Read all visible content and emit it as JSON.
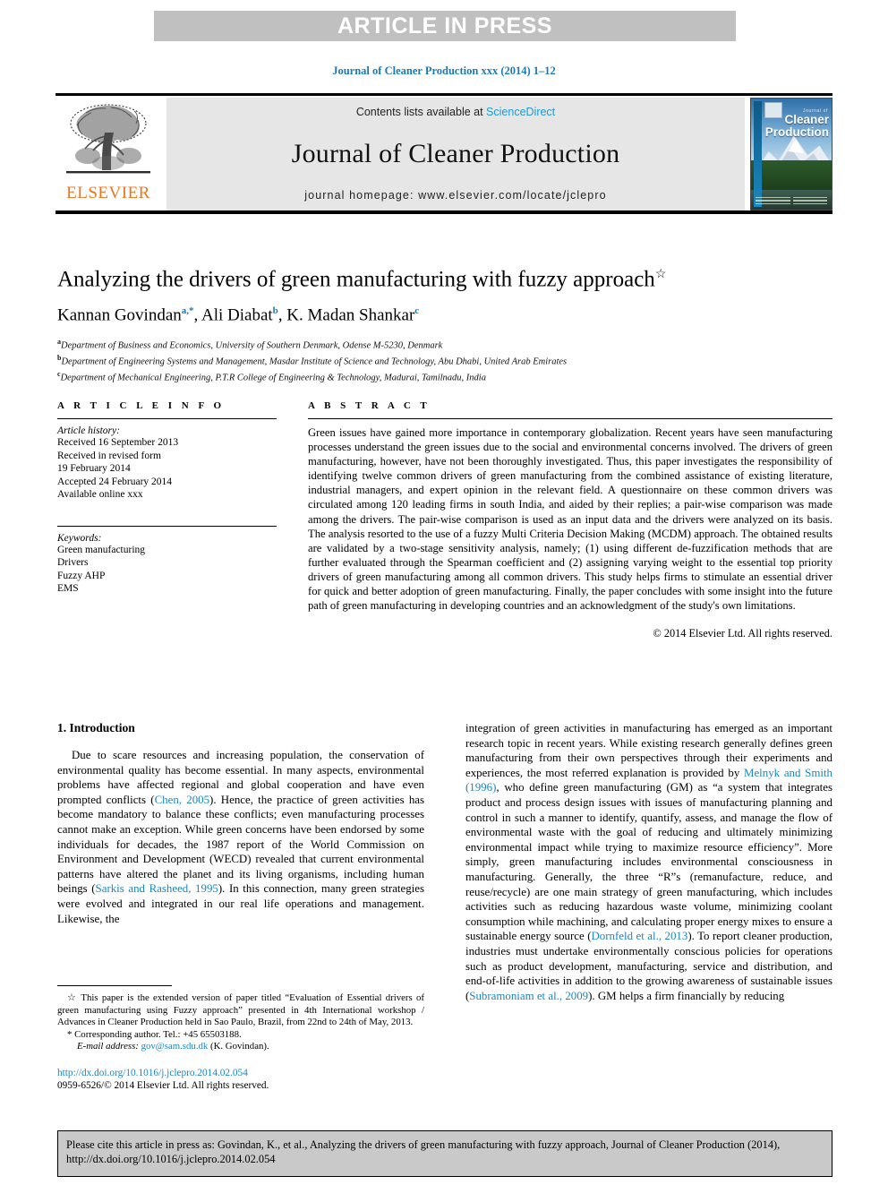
{
  "banner": {
    "text": "ARTICLE IN PRESS"
  },
  "running_head": "Journal of Cleaner Production xxx (2014) 1–12",
  "masthead": {
    "contents_prefix": "Contents lists available at ",
    "sciencedirect": "ScienceDirect",
    "journal_title": "Journal of Cleaner Production",
    "homepage": "journal homepage: www.elsevier.com/locate/jclepro",
    "publisher": "ELSEVIER",
    "cover_kicker": "Journal of",
    "cover_name": "Cleaner Production",
    "link_color": "#1a9bd7",
    "publisher_color": "#e87722"
  },
  "article": {
    "title": "Analyzing the drivers of green manufacturing with fuzzy approach",
    "title_footnote_mark": "☆",
    "authors": "Kannan Govindan , Ali Diabat , K. Madan Shankar",
    "author_list": [
      {
        "name": "Kannan Govindan",
        "marks": "a,*"
      },
      {
        "name": "Ali Diabat",
        "marks": "b"
      },
      {
        "name": "K. Madan Shankar",
        "marks": "c"
      }
    ],
    "affiliations": [
      {
        "mark": "a",
        "text": "Department of Business and Economics, University of Southern Denmark, Odense M-5230, Denmark"
      },
      {
        "mark": "b",
        "text": "Department of Engineering Systems and Management, Masdar Institute of Science and Technology, Abu Dhabi, United Arab Emirates"
      },
      {
        "mark": "c",
        "text": "Department of Mechanical Engineering, P.T.R College of Engineering & Technology, Madurai, Tamilnadu, India"
      }
    ]
  },
  "article_info": {
    "heading": "A R T I C L E  I N F O",
    "history_label": "Article history:",
    "history": [
      "Received 16 September 2013",
      "Received in revised form",
      "19 February 2014",
      "Accepted 24 February 2014",
      "Available online xxx"
    ],
    "keywords_label": "Keywords:",
    "keywords": [
      "Green manufacturing",
      "Drivers",
      "Fuzzy AHP",
      "EMS"
    ]
  },
  "abstract": {
    "heading": "A B S T R A C T",
    "body": "Green issues have gained more importance in contemporary globalization. Recent years have seen manufacturing processes understand the green issues due to the social and environmental concerns involved. The drivers of green manufacturing, however, have not been thoroughly investigated. Thus, this paper investigates the responsibility of identifying twelve common drivers of green manufacturing from the combined assistance of existing literature, industrial managers, and expert opinion in the relevant field. A questionnaire on these common drivers was circulated among 120 leading firms in south India, and aided by their replies; a pair-wise comparison was made among the drivers. The pair-wise comparison is used as an input data and the drivers were analyzed on its basis. The analysis resorted to the use of a fuzzy Multi Criteria Decision Making (MCDM) approach. The obtained results are validated by a two-stage sensitivity analysis, namely; (1) using different de-fuzzification methods that are further evaluated through the Spearman coefficient and (2) assigning varying weight to the essential top priority drivers of green manufacturing among all common drivers. This study helps firms to stimulate an essential driver for quick and better adoption of green manufacturing. Finally, the paper concludes with some insight into the future path of green manufacturing in developing countries and an acknowledgment of the study's own limitations.",
    "copyright": "© 2014 Elsevier Ltd. All rights reserved."
  },
  "introduction": {
    "section_number_title": "1. Introduction",
    "left_para_1": "Due to scare resources and increasing population, the conservation of environmental quality has become essential. In many aspects, environmental problems have affected regional and global cooperation and have even prompted conflicts (",
    "left_ref_1": "Chen, 2005",
    "left_para_2": "). Hence, the practice of green activities has become mandatory to balance these conflicts; even manufacturing processes cannot make an exception. While green concerns have been endorsed by some individuals for decades, the 1987 report of the World Commission on Environment and Development (WECD) revealed that current environmental patterns have altered the planet and its living organisms, including human beings (",
    "left_ref_2": "Sarkis and Rasheed, 1995",
    "left_para_3": "). In this connection, many green strategies were evolved and integrated in our real life operations and management. Likewise, the",
    "right_para_1": "integration of green activities in manufacturing has emerged as an important research topic in recent years. While existing research generally defines green manufacturing from their own perspectives through their experiments and experiences, the most referred explanation is provided by ",
    "right_ref_1": "Melnyk and Smith (1996)",
    "right_para_2": ", who define green manufacturing (GM) as “a system that integrates product and process design issues with issues of manufacturing planning and control in such a manner to identify, quantify, assess, and manage the flow of environmental waste with the goal of reducing and ultimately minimizing environmental impact while trying to maximize resource efficiency”. More simply, green manufacturing includes environmental consciousness in manufacturing. Generally, the three “R”s (remanufacture, reduce, and reuse/recycle) are one main strategy of green manufacturing, which includes activities such as reducing hazardous waste volume, minimizing coolant consumption while machining, and calculating proper energy mixes to ensure a sustainable energy source (",
    "right_ref_2": "Dornfeld et al., 2013",
    "right_para_3": "). To report cleaner production, industries must undertake environmentally conscious policies for operations such as product development, manufacturing, service and distribution, and end-of-life activities in addition to the growing awareness of sustainable issues (",
    "right_ref_3": "Subramoniam et al., 2009",
    "right_para_4": "). GM helps a firm financially by reducing"
  },
  "footnotes": {
    "star_mark": "☆",
    "star_note": " This paper is the extended version of paper titled “Evaluation of Essential drivers of green manufacturing using Fuzzy approach” presented in 4th International workshop / Advances in Cleaner Production held in Sao Paulo, Brazil, from 22nd to 24th of May, 2013.",
    "corresponding_mark": "*",
    "corresponding_note": " Corresponding author. Tel.: +45 65503188.",
    "email_label": "E-mail address:",
    "email": "gov@sam.sdu.dk",
    "email_owner": "(K. Govindan).",
    "doi": "http://dx.doi.org/10.1016/j.jclepro.2014.02.054",
    "issn": "0959-6526/© 2014 Elsevier Ltd. All rights reserved."
  },
  "citation_box": {
    "text": "Please cite this article in press as: Govindan, K., et al., Analyzing the drivers of green manufacturing with fuzzy approach, Journal of Cleaner Production (2014), http://dx.doi.org/10.1016/j.jclepro.2014.02.054"
  }
}
